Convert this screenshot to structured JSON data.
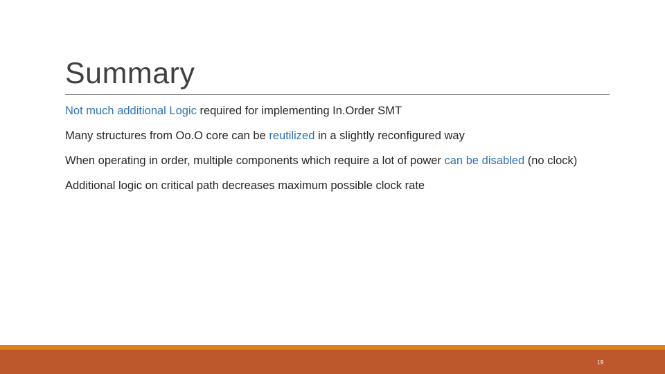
{
  "title": "Summary",
  "bullets": [
    {
      "runs": [
        {
          "t": "Not much additional Logic",
          "hl": true
        },
        {
          "t": " required for implementing In.Order SMT",
          "hl": false
        }
      ]
    },
    {
      "runs": [
        {
          "t": "Many structures from Oo.O core can be ",
          "hl": false
        },
        {
          "t": "reutilized",
          "hl": true
        },
        {
          "t": " in a slightly reconfigured way",
          "hl": false
        }
      ]
    },
    {
      "runs": [
        {
          "t": "When operating in order, multiple components which require a lot of power ",
          "hl": false
        },
        {
          "t": "can be disabled",
          "hl": true
        },
        {
          "t": " (no clock)",
          "hl": false
        }
      ]
    },
    {
      "runs": [
        {
          "t": "Additional logic on critical path decreases maximum possible clock rate",
          "hl": false
        }
      ]
    }
  ],
  "page_number": "19",
  "colors": {
    "accent": "#2e74b5",
    "footer": "#bc582b",
    "footer_stripe": "#e0801a"
  }
}
